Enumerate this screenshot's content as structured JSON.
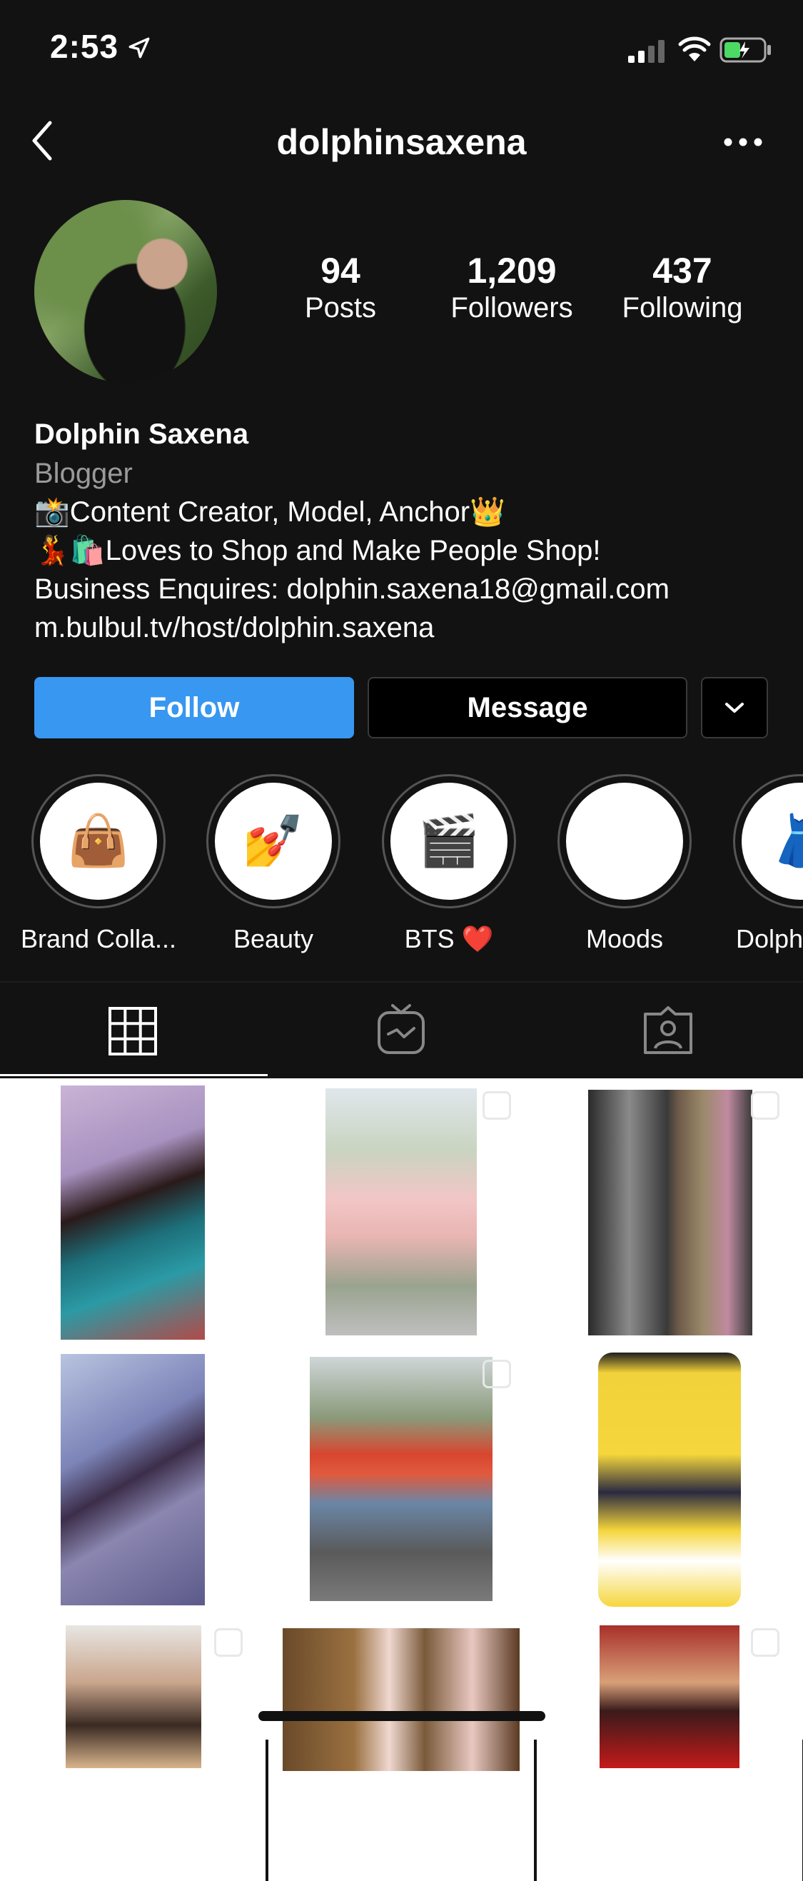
{
  "status_bar": {
    "time": "2:53"
  },
  "nav": {
    "username": "dolphinsaxena"
  },
  "stats": [
    {
      "value": "94",
      "label": "Posts"
    },
    {
      "value": "1,209",
      "label": "Followers"
    },
    {
      "value": "437",
      "label": "Following"
    }
  ],
  "bio": {
    "name": "Dolphin Saxena",
    "category": "Blogger",
    "line1": "📸Content Creator, Model, Anchor👑",
    "line2": "💃🛍️Loves to Shop and Make People Shop!",
    "line3": "Business Enquires: dolphin.saxena18@gmail.com",
    "link": "m.bulbul.tv/host/dolphin.saxena"
  },
  "buttons": {
    "follow": "Follow",
    "message": "Message"
  },
  "highlights": [
    {
      "label": "Brand Colla...",
      "emoji": "👜"
    },
    {
      "label": "Beauty",
      "emoji": "💅"
    },
    {
      "label": "BTS ❤️",
      "emoji": "🎬"
    },
    {
      "label": "Moods",
      "emoji": "😄"
    },
    {
      "label": "Dolphin",
      "emoji": "👗"
    }
  ],
  "colors": {
    "background": "#121212",
    "follow_button": "#3897f0",
    "text": "#ffffff",
    "muted": "#9a9a9a"
  },
  "icons": [
    "location-arrow-icon",
    "signal-icon",
    "wifi-icon",
    "battery-icon",
    "back-icon",
    "more-icon",
    "chevron-down-icon",
    "grid-icon",
    "igtv-icon",
    "tagged-icon"
  ]
}
